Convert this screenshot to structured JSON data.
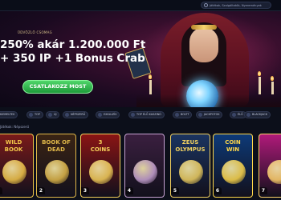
{
  "header": {
    "search_placeholder": "Játékok, Szolgáltatók, Nyeremények"
  },
  "hero": {
    "badge": "ÜDVÖZLŐ CSOMAG",
    "headline_line1": "250% akár 1.200.000 Ft",
    "headline_line2": "+ 350 IP +1 Bonus Crab",
    "cta_label": "CSATLAKOZZ MOST",
    "slides_total": 3,
    "active_slide": 2
  },
  "categories": [
    {
      "label": "KIEMELTEK"
    },
    {
      "label": "TOP"
    },
    {
      "label": "ÚJ"
    },
    {
      "label": "NÉPSZERŰ"
    },
    {
      "label": "EXKLUZÍV"
    },
    {
      "label": "TOP ÉLŐ KASZINÓ"
    },
    {
      "label": "BOLTT"
    },
    {
      "label": "JACKPOTOK"
    },
    {
      "label": "ÉLŐ"
    },
    {
      "label": "BLACKJACK"
    }
  ],
  "section": {
    "label": "Játékok: Népszerű"
  },
  "games": [
    {
      "title_a": "WILD",
      "title_b": "BOOK",
      "rank": "1",
      "bg": "#7a1a1a",
      "accent": "#f2c64a"
    },
    {
      "title_a": "BOOK OF",
      "title_b": "DEAD",
      "rank": "2",
      "bg": "#3a2414",
      "accent": "#e0b84a"
    },
    {
      "title_a": "3",
      "title_b": "COINS",
      "rank": "3",
      "bg": "#8a1414",
      "accent": "#f4cf5a"
    },
    {
      "title_a": "",
      "title_b": "",
      "rank": "4",
      "bg": "#3a1f3f",
      "accent": "#c7a2d2"
    },
    {
      "title_a": "ZEUS",
      "title_b": "OLYMPUS",
      "rank": "5",
      "bg": "#1b3460",
      "accent": "#f0d060"
    },
    {
      "title_a": "COIN",
      "title_b": "WIN",
      "rank": "6",
      "bg": "#0d3a78",
      "accent": "#ffd84a"
    },
    {
      "title_a": "",
      "title_b": "",
      "rank": "7",
      "bg": "#b01a7a",
      "accent": "#ffd26a"
    }
  ]
}
